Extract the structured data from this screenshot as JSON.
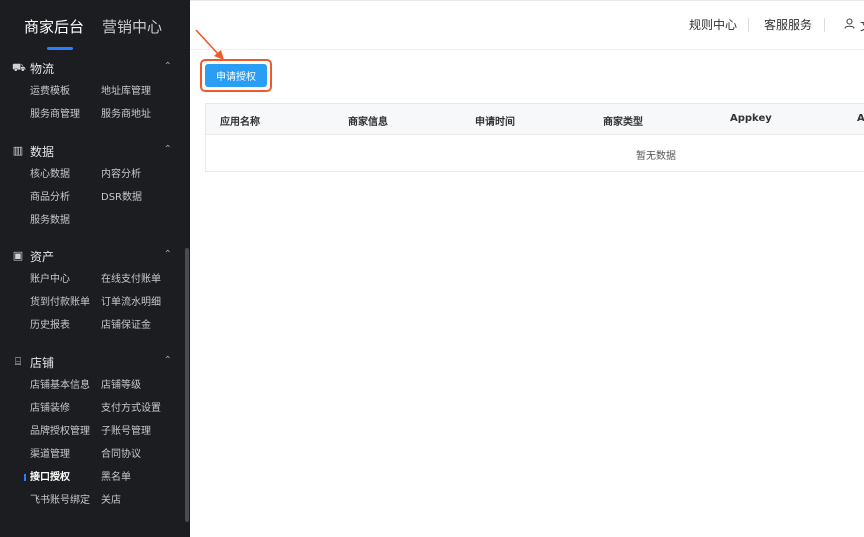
{
  "sidebar": {
    "brand_tabs": [
      "商家后台",
      "营销中心"
    ],
    "sections": [
      {
        "title": "物流",
        "icon": "truck-icon",
        "items": [
          "运费模板",
          "地址库管理",
          "服务商管理",
          "服务商地址"
        ]
      },
      {
        "title": "数据",
        "icon": "bar-chart-icon",
        "items": [
          "核心数据",
          "内容分析",
          "商品分析",
          "DSR数据",
          "服务数据"
        ]
      },
      {
        "title": "资产",
        "icon": "wallet-icon",
        "items": [
          "账户中心",
          "在线支付账单",
          "货到付款账单",
          "订单流水明细",
          "历史报表",
          "店铺保证金"
        ]
      },
      {
        "title": "店铺",
        "icon": "store-icon",
        "items": [
          "店铺基本信息",
          "店铺等级",
          "店铺装修",
          "支付方式设置",
          "品牌授权管理",
          "子账号管理",
          "渠道管理",
          "合同协议",
          "接口授权",
          "黑名单",
          "飞书账号绑定",
          "关店"
        ]
      }
    ],
    "active_item": "接口授权"
  },
  "topbar": {
    "rule_center": "规则中心",
    "customer_service": "客服服务",
    "user_name_trunc": "文"
  },
  "main": {
    "apply_button": "申请授权",
    "table": {
      "columns": [
        "应用名称",
        "商家信息",
        "申请时间",
        "商家类型",
        "Appkey",
        "A"
      ],
      "empty_text": "暂无数据"
    }
  },
  "colors": {
    "sidebar_bg": "#1c1d21",
    "accent_blue": "#2b7cff",
    "button_blue": "#2a9df4",
    "highlight_orange": "#f05a28"
  }
}
